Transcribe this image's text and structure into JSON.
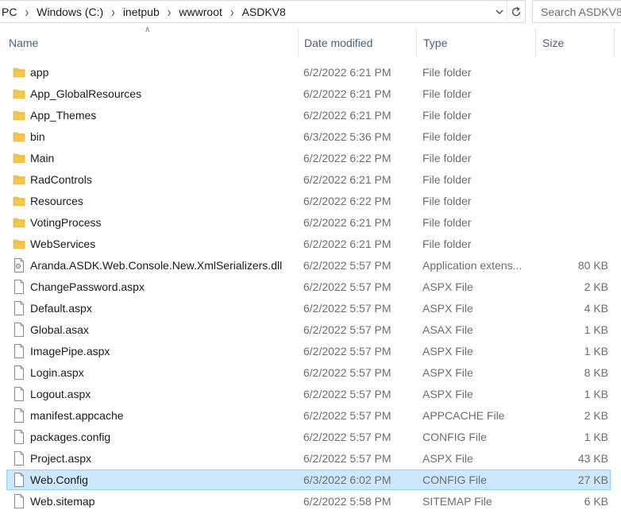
{
  "address_bar": {
    "crumbs": [
      "PC",
      "Windows (C:)",
      "inetpub",
      "wwwroot",
      "ASDKV8"
    ]
  },
  "search": {
    "placeholder": "Search ASDKV8"
  },
  "columns": {
    "name": "Name",
    "date": "Date modified",
    "type": "Type",
    "size": "Size"
  },
  "colors": {
    "folder": "#f5c84d",
    "selected_bg": "#cce8ff",
    "selected_border": "#99d1ff"
  },
  "files": [
    {
      "name": "app",
      "date": "6/2/2022 6:21 PM",
      "type": "File folder",
      "size": "",
      "icon": "folder-icon"
    },
    {
      "name": "App_GlobalResources",
      "date": "6/2/2022 6:21 PM",
      "type": "File folder",
      "size": "",
      "icon": "folder-icon"
    },
    {
      "name": "App_Themes",
      "date": "6/2/2022 6:21 PM",
      "type": "File folder",
      "size": "",
      "icon": "folder-icon"
    },
    {
      "name": "bin",
      "date": "6/3/2022 5:36 PM",
      "type": "File folder",
      "size": "",
      "icon": "folder-icon"
    },
    {
      "name": "Main",
      "date": "6/2/2022 6:22 PM",
      "type": "File folder",
      "size": "",
      "icon": "folder-icon"
    },
    {
      "name": "RadControls",
      "date": "6/2/2022 6:21 PM",
      "type": "File folder",
      "size": "",
      "icon": "folder-icon"
    },
    {
      "name": "Resources",
      "date": "6/2/2022 6:22 PM",
      "type": "File folder",
      "size": "",
      "icon": "folder-icon"
    },
    {
      "name": "VotingProcess",
      "date": "6/2/2022 6:21 PM",
      "type": "File folder",
      "size": "",
      "icon": "folder-icon"
    },
    {
      "name": "WebServices",
      "date": "6/2/2022 6:21 PM",
      "type": "File folder",
      "size": "",
      "icon": "folder-icon"
    },
    {
      "name": "Aranda.ASDK.Web.Console.New.XmlSerializers.dll",
      "date": "6/2/2022 5:57 PM",
      "type": "Application extens...",
      "size": "80 KB",
      "icon": "dll-file-icon"
    },
    {
      "name": "ChangePassword.aspx",
      "date": "6/2/2022 5:57 PM",
      "type": "ASPX File",
      "size": "2 KB",
      "icon": "file-icon"
    },
    {
      "name": "Default.aspx",
      "date": "6/2/2022 5:57 PM",
      "type": "ASPX File",
      "size": "4 KB",
      "icon": "file-icon"
    },
    {
      "name": "Global.asax",
      "date": "6/2/2022 5:57 PM",
      "type": "ASAX File",
      "size": "1 KB",
      "icon": "file-icon"
    },
    {
      "name": "ImagePipe.aspx",
      "date": "6/2/2022 5:57 PM",
      "type": "ASPX File",
      "size": "1 KB",
      "icon": "file-icon"
    },
    {
      "name": "Login.aspx",
      "date": "6/2/2022 5:57 PM",
      "type": "ASPX File",
      "size": "8 KB",
      "icon": "file-icon"
    },
    {
      "name": "Logout.aspx",
      "date": "6/2/2022 5:57 PM",
      "type": "ASPX File",
      "size": "1 KB",
      "icon": "file-icon"
    },
    {
      "name": "manifest.appcache",
      "date": "6/2/2022 5:57 PM",
      "type": "APPCACHE File",
      "size": "2 KB",
      "icon": "file-icon"
    },
    {
      "name": "packages.config",
      "date": "6/2/2022 5:57 PM",
      "type": "CONFIG File",
      "size": "1 KB",
      "icon": "file-icon"
    },
    {
      "name": "Project.aspx",
      "date": "6/2/2022 5:57 PM",
      "type": "ASPX File",
      "size": "43 KB",
      "icon": "file-icon"
    },
    {
      "name": "Web.Config",
      "date": "6/3/2022 6:02 PM",
      "type": "CONFIG File",
      "size": "27 KB",
      "icon": "file-icon",
      "selected": true
    },
    {
      "name": "Web.sitemap",
      "date": "6/2/2022 5:58 PM",
      "type": "SITEMAP File",
      "size": "6 KB",
      "icon": "file-icon"
    }
  ]
}
